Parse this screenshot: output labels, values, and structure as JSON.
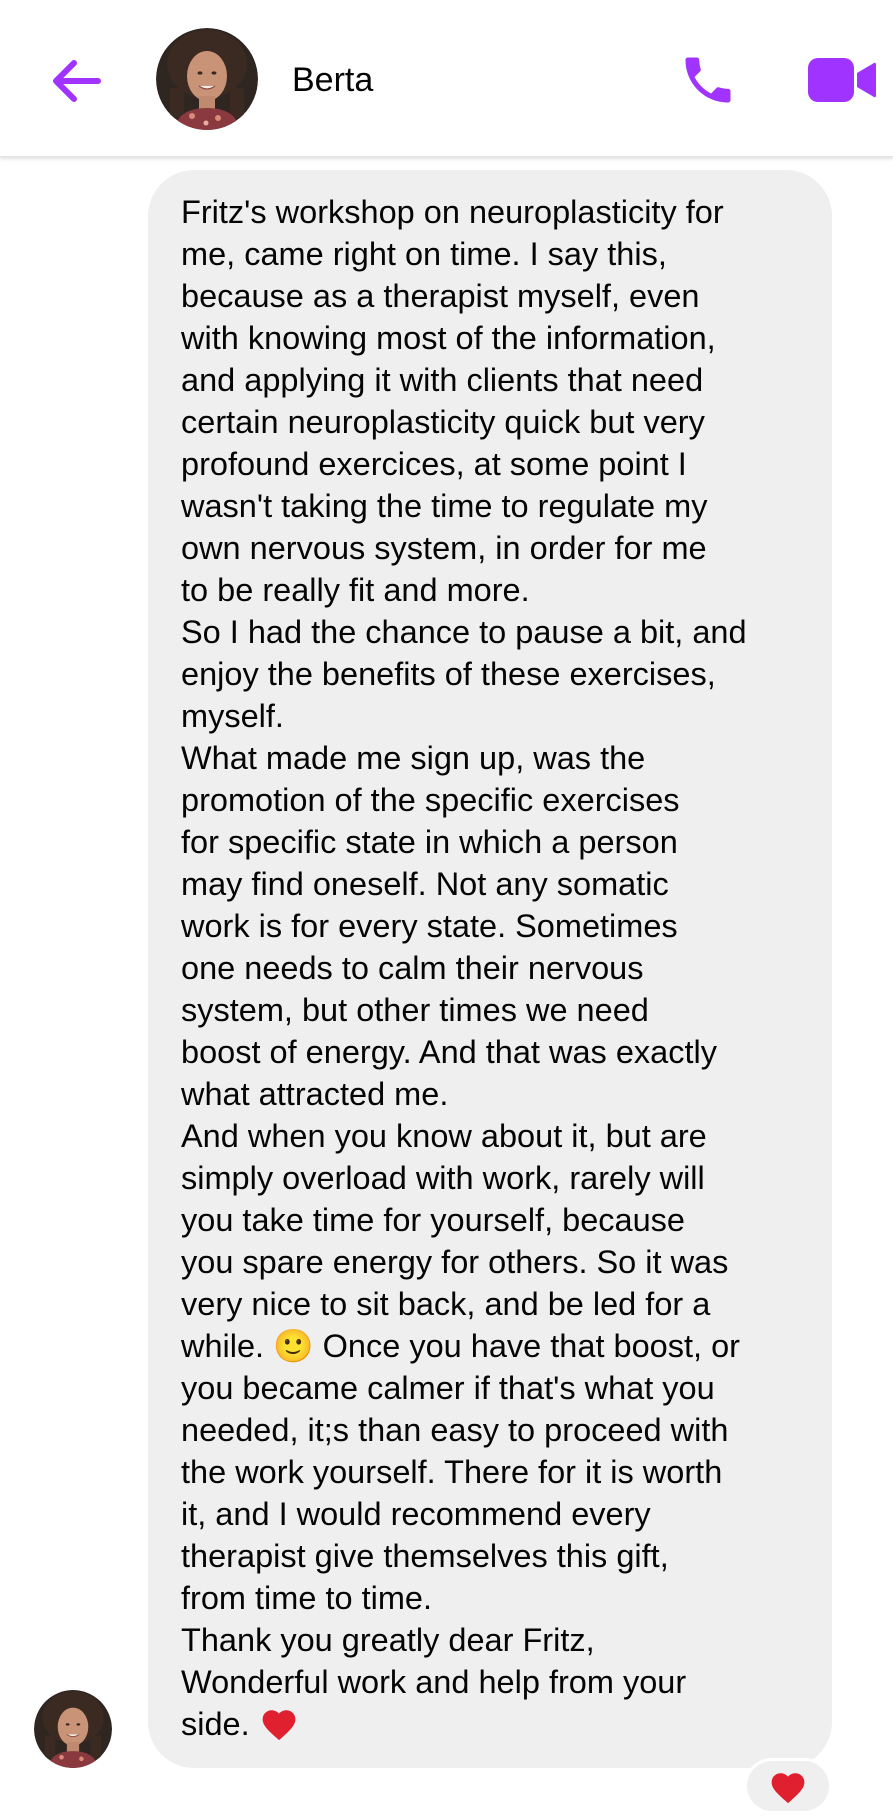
{
  "header": {
    "contact_name": "Berta",
    "back_icon": "arrow-left-icon",
    "call_icon": "phone-icon",
    "video_icon": "video-camera-icon"
  },
  "conversation": {
    "message": {
      "paragraphs": [
        "Fritz's workshop on neuroplasticity for\nme, came right on time. I say this,\nbecause as a therapist myself, even\nwith knowing most of the information,\nand applying it with clients that need\ncertain neuroplasticity quick but very\nprofound exercices, at some point I\nwasn't taking the time to regulate my\nown nervous system, in order for me\nto be really fit and more.",
        "So I had the chance to pause a bit, and\nenjoy the benefits of these exercises,\nmyself.",
        "What made me sign up, was the\npromotion of the specific exercises\nfor specific state in which a person\nmay find oneself. Not any somatic\nwork is for every state. Sometimes\none needs to calm their nervous\nsystem, but other times we need\nboost of energy. And that was exactly\nwhat attracted me."
      ],
      "p4_before_emoji": "And when you know about it, but are\nsimply overload with work, rarely will\nyou take time for yourself, because\nyou spare energy for others. So it was\nvery nice to sit back, and be led for a\nwhile. ",
      "smile_emoji": "🙂",
      "p4_after_emoji": " Once you have that boost, or\nyou became calmer if that's what you\nneeded, it;s than easy to proceed with\nthe work yourself. There for it is worth\nit, and I would recommend every\ntherapist give themselves this gift,\nfrom time to time.",
      "p5_text": "Thank you greatly dear Fritz,\nWonderful work and help from your\nside. ",
      "heart_icon": "red-heart-icon"
    },
    "reaction_icon": "red-heart-icon"
  },
  "colors": {
    "accent": "#a033ff",
    "bubble": "#efefef",
    "text": "#050505",
    "heart": "#e0202e"
  }
}
